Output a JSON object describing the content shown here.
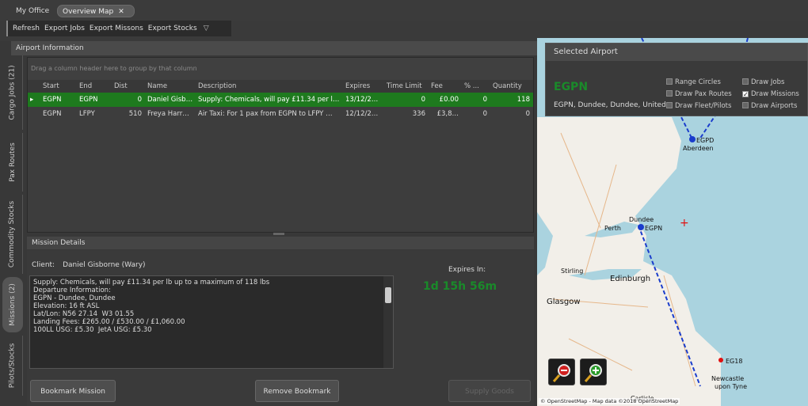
{
  "tabs": [
    "My Office",
    "Overview Map"
  ],
  "tab_close": "✕",
  "toolbar": {
    "refresh": "Refresh",
    "export_jobs": "Export Jobs",
    "export_missions": "Export Missons",
    "export_stocks": "Export Stocks"
  },
  "airport_info_title": "Airport Information",
  "side_tabs": [
    "Cargo Jobs (21)",
    "Pax Routes",
    "Commodity Stocks",
    "Missions (2)",
    "Pilots/Stocks"
  ],
  "grid": {
    "group_hint": "Drag a column header here to group by that column",
    "columns": [
      "Start",
      "End",
      "Dist",
      "Name",
      "Description",
      "Expires",
      "Time Limit",
      "Fee",
      "% ...",
      "Quantity"
    ],
    "rows": [
      {
        "arrow": "▸",
        "start": "EGPN",
        "end": "EGPN",
        "dist": "0",
        "name": "Daniel Gisb…",
        "desc": "Supply: Chemicals, will pay £11.34 per l…",
        "expires": "13/12/2…",
        "timelimit": "0",
        "fee": "£0.00",
        "pct": "0",
        "qty": "118"
      },
      {
        "arrow": "",
        "start": "EGPN",
        "end": "LFPY",
        "dist": "510",
        "name": "Freya Harr…",
        "desc": "Air Taxi: For 1 pax from EGPN to LFPY …",
        "expires": "12/12/2…",
        "timelimit": "336",
        "fee": "£3,8…",
        "pct": "0",
        "qty": "0"
      }
    ]
  },
  "mission": {
    "title": "Mission Details",
    "client_label": "Client:",
    "client_name": "Daniel Gisborne  (Wary)",
    "description_lines": [
      "Supply: Chemicals, will pay £11.34 per lb up to a maximum of 118 lbs",
      "",
      "Departure Information:",
      "EGPN - Dundee, Dundee",
      "",
      "Elevation: 16 ft ASL",
      "Lat/Lon: N56 27.14  W3 01.55",
      "Landing Fees: £265.00 / £530.00 / £1,060.00",
      "100LL USG: £5.30  JetA USG: £5.30"
    ],
    "expires_label": "Expires In:",
    "expires_value": "1d 15h 56m",
    "buttons": {
      "bookmark": "Bookmark Mission",
      "remove": "Remove Bookmark",
      "supply": "Supply Goods"
    }
  },
  "selected_airport": {
    "title": "Selected Airport",
    "code": "EGPN",
    "name": "EGPN, Dundee, Dundee, United Kingdom",
    "options": {
      "range_circles": "Range Circles",
      "draw_jobs": "Draw Jobs",
      "draw_pax": "Draw Pax Routes",
      "draw_missions": "Draw Missions",
      "draw_fleet": "Draw Fleet/Pilots",
      "draw_airports": "Draw Airports"
    },
    "draw_missions_checked": true
  },
  "map": {
    "labels": {
      "egpd": "EGPD",
      "aberdeen": "Aberdeen",
      "dundee": "Dundee",
      "egpn": "EGPN",
      "perth": "Perth",
      "stirling": "Stirling",
      "edinburgh": "Edinburgh",
      "glasgow": "Glasgow",
      "eg18": "EG18",
      "newcastle1": "Newcastle",
      "newcastle2": "upon Tyne",
      "carlisle": "Carlisle"
    },
    "copyright": "© OpenStreetMap - Map data ©2018 OpenStreetMap"
  },
  "colors": {
    "selected_row": "#1e7a1e",
    "accent_green": "#1a8a2a",
    "route": "#1a3ccc"
  }
}
